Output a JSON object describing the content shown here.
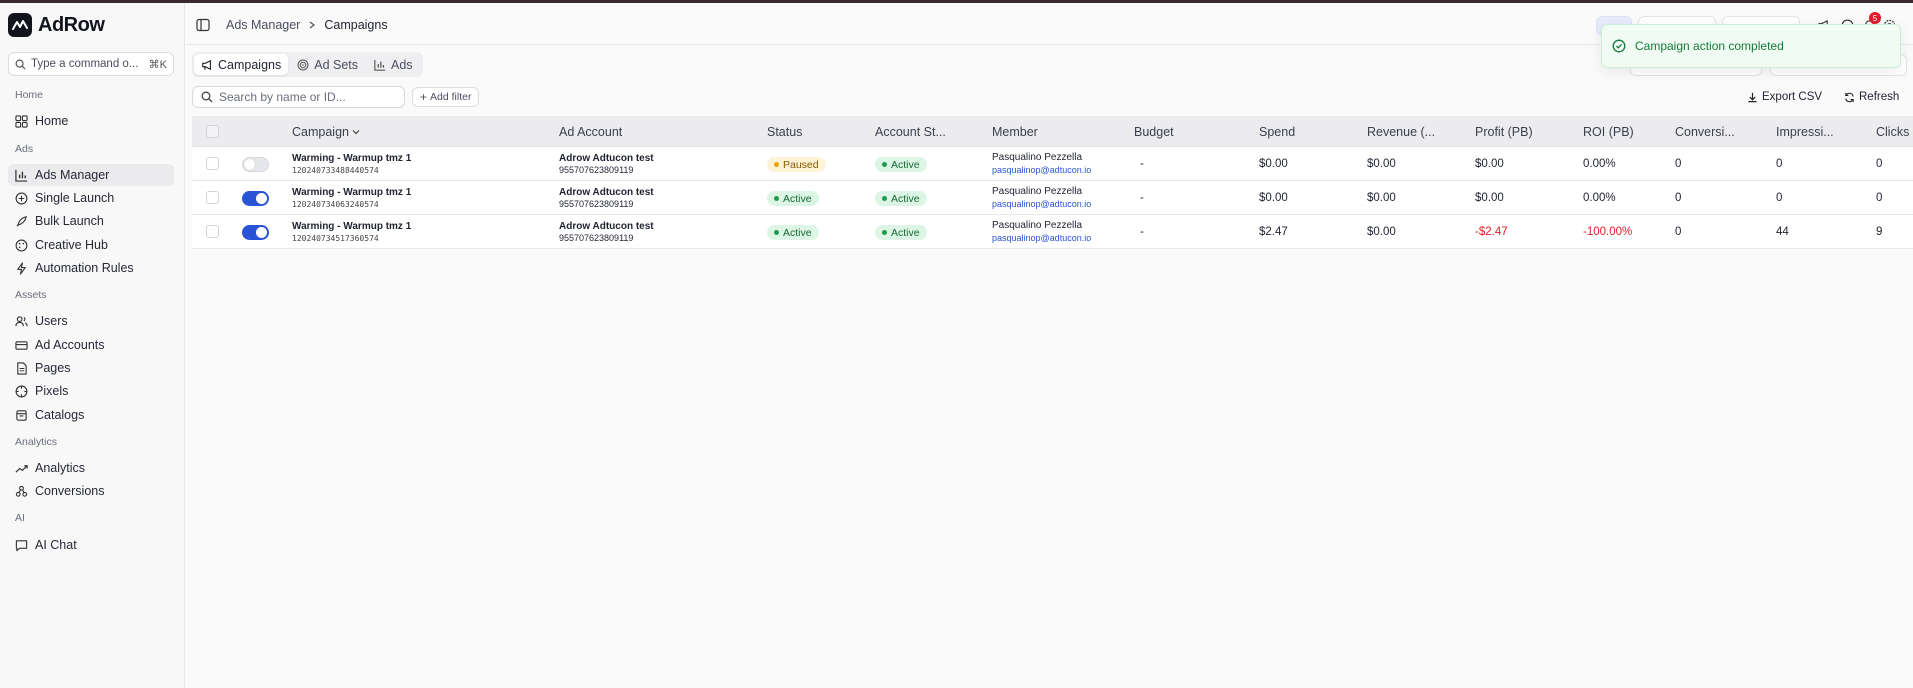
{
  "app": {
    "name": "AdRow"
  },
  "command": {
    "placeholder": "Type a command o...",
    "shortcut": "⌘K"
  },
  "sidebar": {
    "sections": [
      {
        "label": "Home",
        "items": [
          {
            "label": "Home",
            "icon": "grid-icon"
          }
        ]
      },
      {
        "label": "Ads",
        "items": [
          {
            "label": "Ads Manager",
            "icon": "bar-chart-icon",
            "active": true
          },
          {
            "label": "Single Launch",
            "icon": "plus-circle-icon"
          },
          {
            "label": "Bulk Launch",
            "icon": "rocket-icon"
          },
          {
            "label": "Creative Hub",
            "icon": "palette-icon"
          },
          {
            "label": "Automation Rules",
            "icon": "zap-icon"
          }
        ]
      },
      {
        "label": "Assets",
        "items": [
          {
            "label": "Users",
            "icon": "users-icon"
          },
          {
            "label": "Ad Accounts",
            "icon": "credit-card-icon"
          },
          {
            "label": "Pages",
            "icon": "file-icon"
          },
          {
            "label": "Pixels",
            "icon": "target-icon"
          },
          {
            "label": "Catalogs",
            "icon": "package-icon"
          }
        ]
      },
      {
        "label": "Analytics",
        "items": [
          {
            "label": "Analytics",
            "icon": "trending-up-icon"
          },
          {
            "label": "Conversions",
            "icon": "workflow-icon"
          }
        ]
      },
      {
        "label": "AI",
        "items": [
          {
            "label": "AI Chat",
            "icon": "message-square-icon"
          }
        ]
      }
    ]
  },
  "header": {
    "breadcrumb": [
      "Ads Manager",
      "Campaigns"
    ],
    "notification_count": "5"
  },
  "tabs": [
    {
      "label": "Campaigns",
      "icon": "megaphone-icon",
      "active": true
    },
    {
      "label": "Ad Sets",
      "icon": "target-icon"
    },
    {
      "label": "Ads",
      "icon": "bar-chart-icon"
    }
  ],
  "toolbar": {
    "search_placeholder": "Search by name or ID...",
    "add_filter": "Add filter",
    "export": "Export CSV",
    "refresh": "Refresh"
  },
  "toast": {
    "message": "Campaign action completed"
  },
  "table": {
    "columns": [
      "Campaign",
      "Ad Account",
      "Status",
      "Account St...",
      "Member",
      "Budget",
      "Spend",
      "Revenue (...",
      "Profit (PB)",
      "ROI (PB)",
      "Conversi...",
      "Impressi...",
      "Clicks"
    ],
    "rows": [
      {
        "enabled": false,
        "name": "Warming - Warmup tmz 1",
        "id": "120240733488440574",
        "account": "Adrow Adtucon test",
        "account_id": "955707623809119",
        "status": "Paused",
        "account_status": "Active",
        "member_name": "Pasqualino Pezzella",
        "member_email": "pasqualinop@adtucon.io",
        "budget": "-",
        "spend": "$0.00",
        "revenue": "$0.00",
        "profit": "$0.00",
        "roi": "0.00%",
        "conversions": "0",
        "impressions": "0",
        "clicks": "0",
        "negative": false
      },
      {
        "enabled": true,
        "name": "Warming - Warmup tmz 1",
        "id": "120240734063240574",
        "account": "Adrow Adtucon test",
        "account_id": "955707623809119",
        "status": "Active",
        "account_status": "Active",
        "member_name": "Pasqualino Pezzella",
        "member_email": "pasqualinop@adtucon.io",
        "budget": "-",
        "spend": "$0.00",
        "revenue": "$0.00",
        "profit": "$0.00",
        "roi": "0.00%",
        "conversions": "0",
        "impressions": "0",
        "clicks": "0",
        "negative": false
      },
      {
        "enabled": true,
        "name": "Warming - Warmup tmz 1",
        "id": "120240734517360574",
        "account": "Adrow Adtucon test",
        "account_id": "955707623809119",
        "status": "Active",
        "account_status": "Active",
        "member_name": "Pasqualino Pezzella",
        "member_email": "pasqualinop@adtucon.io",
        "budget": "-",
        "spend": "$2.47",
        "revenue": "$0.00",
        "profit": "-$2.47",
        "roi": "-100.00%",
        "conversions": "0",
        "impressions": "44",
        "clicks": "9",
        "negative": true
      }
    ]
  },
  "colors": {
    "accent": "#2a54d6",
    "paused_bg": "#fdf3d7",
    "paused_dot": "#e8a400",
    "active_bg": "#dcf5e4",
    "active_dot": "#1f9a4c",
    "negative": "#e11d2a"
  }
}
